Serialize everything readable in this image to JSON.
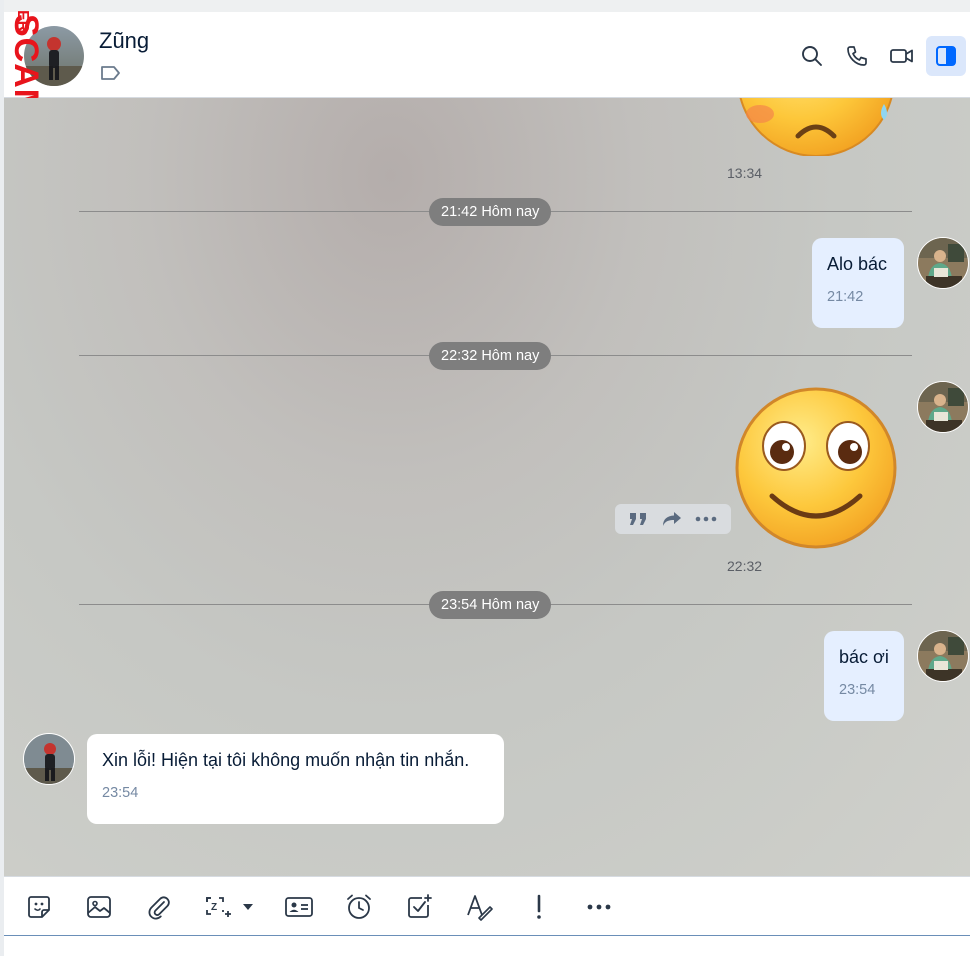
{
  "header": {
    "contact_name": "Zũng",
    "buttons": {
      "search": "search-icon",
      "call": "phone-icon",
      "video": "video-call-icon",
      "panel": "sidebar-toggle-icon"
    }
  },
  "watermark": {
    "text": "SCAM.INFO",
    "prefix": "ER"
  },
  "messages": {
    "prev_time": "13:34",
    "divider1": "21:42 Hôm nay",
    "msg1_text": "Alo bác",
    "msg1_time": "21:42",
    "divider2": "22:32 Hôm nay",
    "sticker_time": "22:32",
    "divider3": "23:54 Hôm nay",
    "msg2_text": "bác ơi",
    "msg2_time": "23:54",
    "reply_text": "Xin lỗi! Hiện tại tôi không muốn nhận tin nhắn.",
    "reply_time": "23:54"
  },
  "actions": {
    "quote": "quote-icon",
    "forward": "forward-icon",
    "more": "more-icon"
  },
  "toolbar": {
    "items": [
      "sticker-icon",
      "image-icon",
      "attachment-icon",
      "screenshot-icon",
      "contact-card-icon",
      "reminder-icon",
      "task-icon",
      "text-format-icon",
      "urgent-icon",
      "more-icon"
    ]
  },
  "colors": {
    "accent": "#0068ff",
    "my_bubble": "#e5efff",
    "their_bubble": "#ffffff",
    "watermark": "#e8141c"
  }
}
